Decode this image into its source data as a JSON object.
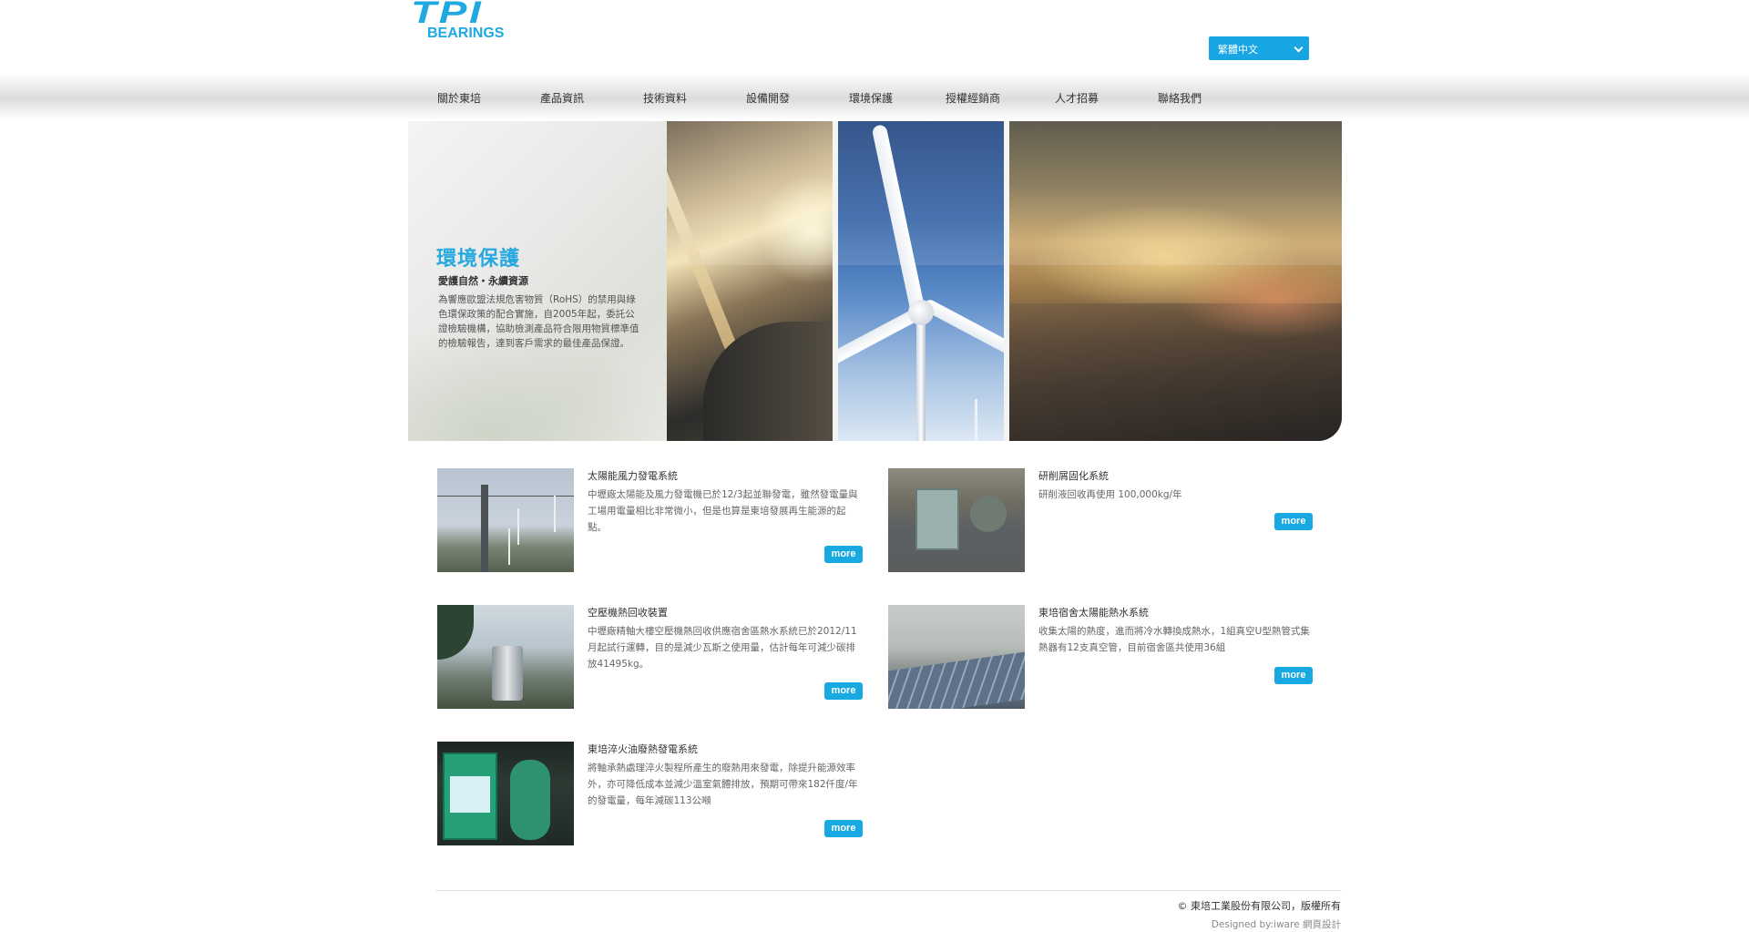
{
  "header": {
    "logo_top": "TPI",
    "logo_bottom": "BEARINGS",
    "language": "繁體中文"
  },
  "nav": {
    "items": [
      "關於東培",
      "產品資訊",
      "技術資料",
      "設備開發",
      "環境保護",
      "授權經銷商",
      "人才招募",
      "聯絡我們"
    ]
  },
  "hero": {
    "title": "環境保護",
    "subtitle": "愛護自然・永續資源",
    "text": "為響應歐盟法規危害物質（RoHS）的禁用與綠色環保政策的配合實施，自2005年起，委託公證檢驗機構，協助檢測產品符合限用物質標準值的檢驗報告，達到客戶需求的最佳產品保證。"
  },
  "cards": [
    {
      "title": "太陽能風力發電系統",
      "text": "中壢廠太陽能及風力發電機已於12/3起並聯發電，雖然發電量與工場用電量相比非常微小，但是也算是東培發展再生能源的起點。",
      "more": "more"
    },
    {
      "title": "研削屑固化系統",
      "text": "研削液回收再使用 100,000kg/年",
      "more": "more"
    },
    {
      "title": "空壓機熱回收裝置",
      "text": "中壢廠精軸大樓空壓機熱回收供應宿舍區熱水系統已於2012/11月起試行運轉，目的是減少瓦斯之使用量，估計每年可減少碳排放41495kg。",
      "more": "more"
    },
    {
      "title": "東培宿舍太陽能熱水系統",
      "text": "收集太陽的熱度，進而將冷水轉換成熱水，1組真空U型熱管式集熱器有12支真空管，目前宿舍區共使用36組",
      "more": "more"
    },
    {
      "title": "東培淬火油廢熱發電系統",
      "text": "將軸承熱處理淬火製程所產生的廢熱用來發電，除提升能源效率外，亦可降低成本並減少溫室氣體排放，預期可帶來182仟度/年的發電量，每年減碳113公噸",
      "more": "more"
    }
  ],
  "footer": {
    "copyright": "© 東培工業股份有限公司，版權所有",
    "designer": "Designed by:iware 網頁設計"
  },
  "colors": {
    "accent": "#18a9e3",
    "logo": "#1fa9e0",
    "hero_title": "#26a9e0"
  }
}
